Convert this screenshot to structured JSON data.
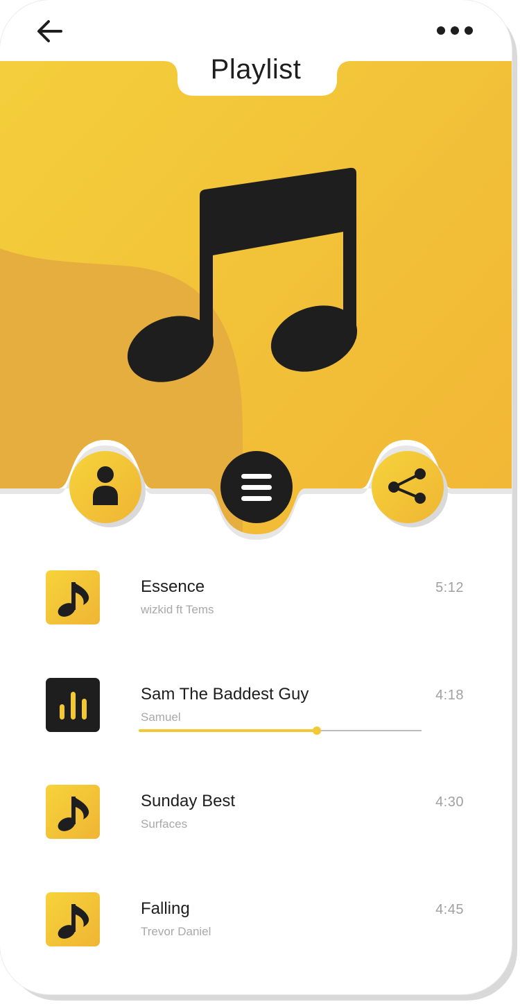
{
  "header": {
    "title": "Playlist",
    "back_icon": "arrow-left-icon",
    "more_icon": "more-horizontal-icon"
  },
  "hero": {
    "artwork_icon": "music-note-icon",
    "actions": [
      {
        "name": "profile",
        "icon": "person-icon"
      },
      {
        "name": "menu",
        "icon": "menu-icon"
      },
      {
        "name": "share",
        "icon": "share-icon"
      }
    ]
  },
  "tracks": [
    {
      "title": "Essence",
      "artist": "wizkid ft Tems",
      "duration": "5:12",
      "icon": "music-note-icon",
      "playing": false
    },
    {
      "title": "Sam The Baddest Guy",
      "artist": "Samuel",
      "duration": "4:18",
      "icon": "equalizer-icon",
      "playing": true,
      "progress": 0.63
    },
    {
      "title": "Sunday Best",
      "artist": "Surfaces",
      "duration": "4:30",
      "icon": "music-note-icon",
      "playing": false
    },
    {
      "title": "Falling",
      "artist": "Trevor Daniel",
      "duration": "4:45",
      "icon": "music-note-icon",
      "playing": false
    }
  ],
  "colors": {
    "accent": "#f2c935",
    "accent_dark": "#e6ae3f",
    "ink": "#1e1e1e",
    "muted": "#a8a8a8"
  }
}
